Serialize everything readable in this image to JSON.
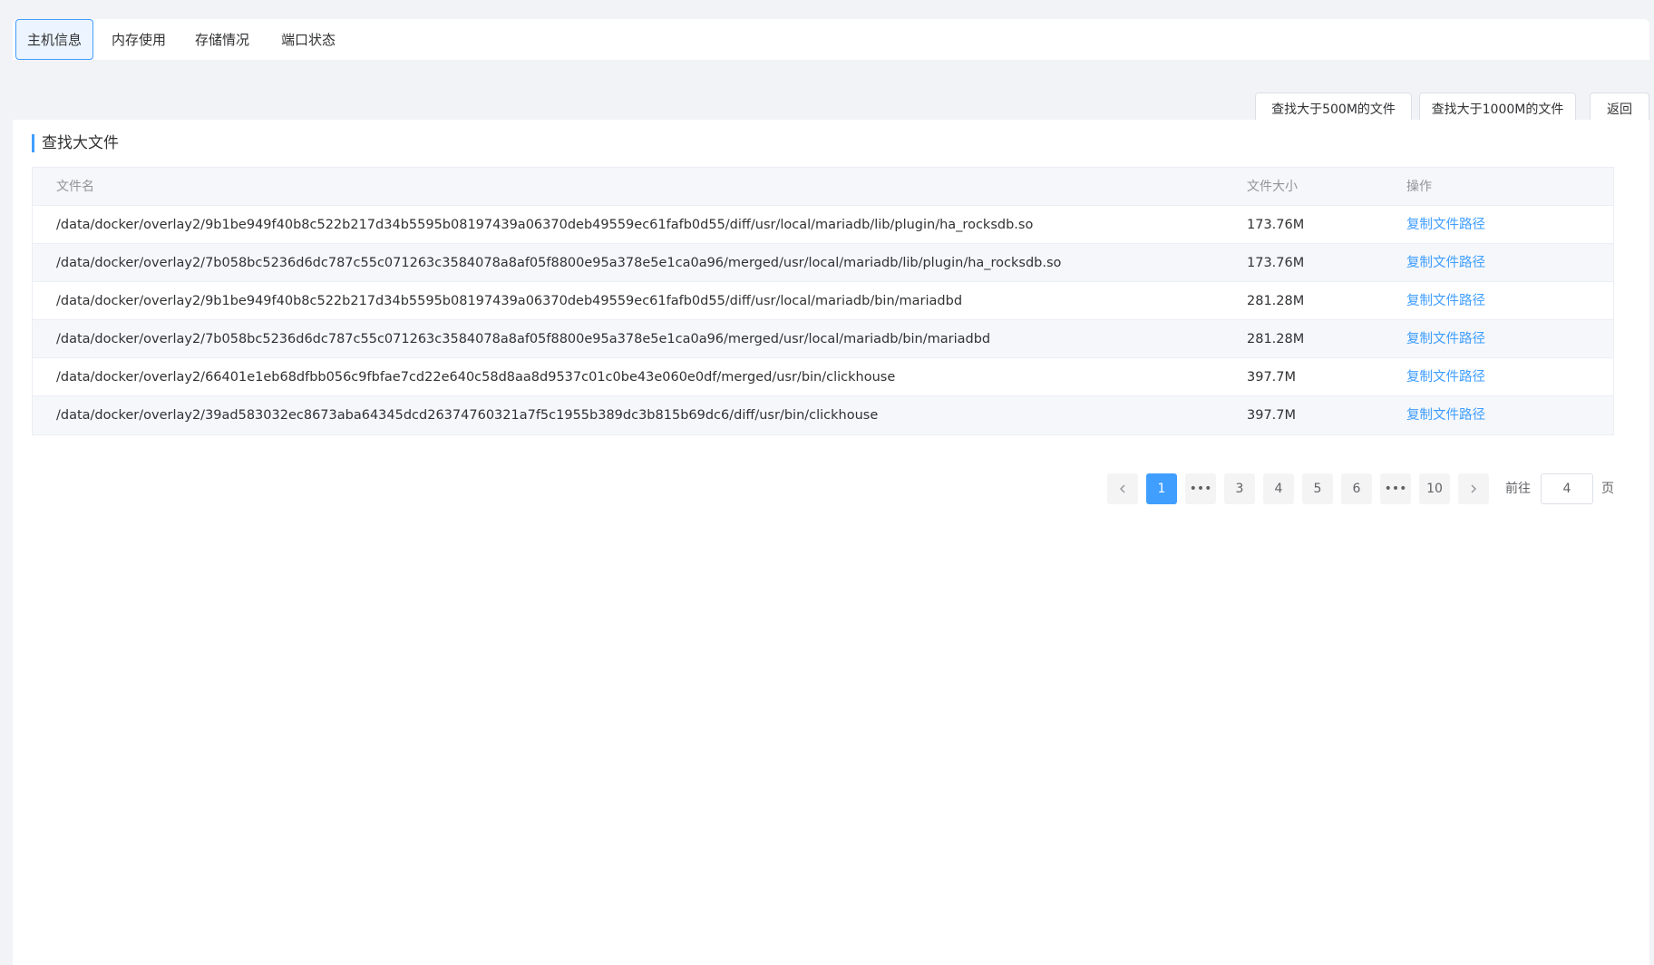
{
  "tabs": [
    {
      "label": "主机信息",
      "active": true
    },
    {
      "label": "内存使用",
      "active": false
    },
    {
      "label": "存储情况",
      "active": false
    },
    {
      "label": "端口状态",
      "active": false
    }
  ],
  "toolbar": {
    "find_500_label": "查找大于500M的文件",
    "find_1000_label": "查找大于1000M的文件",
    "back_label": "返回"
  },
  "section": {
    "title": "查找大文件"
  },
  "table": {
    "headers": {
      "name": "文件名",
      "size": "文件大小",
      "op": "操作"
    },
    "rows": [
      {
        "name": "/data/docker/overlay2/9b1be949f40b8c522b217d34b5595b08197439a06370deb49559ec61fafb0d55/diff/usr/local/mariadb/lib/plugin/ha_rocksdb.so",
        "size": "173.76M",
        "op": "复制文件路径"
      },
      {
        "name": "/data/docker/overlay2/7b058bc5236d6dc787c55c071263c3584078a8af05f8800e95a378e5e1ca0a96/merged/usr/local/mariadb/lib/plugin/ha_rocksdb.so",
        "size": "173.76M",
        "op": "复制文件路径"
      },
      {
        "name": "/data/docker/overlay2/9b1be949f40b8c522b217d34b5595b08197439a06370deb49559ec61fafb0d55/diff/usr/local/mariadb/bin/mariadbd",
        "size": "281.28M",
        "op": "复制文件路径"
      },
      {
        "name": "/data/docker/overlay2/7b058bc5236d6dc787c55c071263c3584078a8af05f8800e95a378e5e1ca0a96/merged/usr/local/mariadb/bin/mariadbd",
        "size": "281.28M",
        "op": "复制文件路径"
      },
      {
        "name": "/data/docker/overlay2/66401e1eb68dfbb056c9fbfae7cd22e640c58d8aa8d9537c01c0be43e060e0df/merged/usr/bin/clickhouse",
        "size": "397.7M",
        "op": "复制文件路径"
      },
      {
        "name": "/data/docker/overlay2/39ad583032ec8673aba64345dcd26374760321a7f5c1955b389dc3b815b69dc6/diff/usr/bin/clickhouse",
        "size": "397.7M",
        "op": "复制文件路径"
      }
    ]
  },
  "pagination": {
    "pages": [
      "1",
      "3",
      "4",
      "5",
      "6",
      "10"
    ],
    "current": "1",
    "ellipsis": "•••",
    "goto_prefix": "前往",
    "goto_value": "4",
    "goto_suffix": "页"
  },
  "colors": {
    "accent": "#409eff",
    "stripe": "#f5f7fa"
  }
}
